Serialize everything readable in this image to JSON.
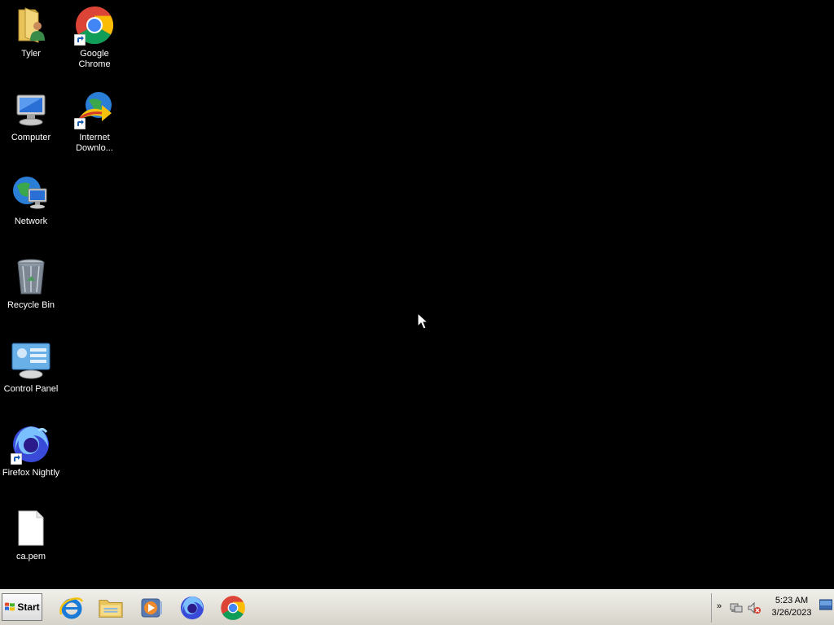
{
  "desktop": {
    "icons": [
      {
        "label": "Tyler",
        "icon": "user-folder-icon"
      },
      {
        "label": "Google Chrome",
        "icon": "chrome-icon"
      },
      {
        "label": "Computer",
        "icon": "computer-icon"
      },
      {
        "label": "Internet Downlo...",
        "label_line1": "Internet",
        "label_line2": "Downlo...",
        "icon": "internet-download-manager-icon"
      },
      {
        "label": "Network",
        "icon": "network-icon"
      },
      {
        "label": "Recycle Bin",
        "icon": "recycle-bin-icon"
      },
      {
        "label": "Control Panel",
        "icon": "control-panel-icon"
      },
      {
        "label": "Firefox Nightly",
        "icon": "firefox-nightly-icon"
      },
      {
        "label": "ca.pem",
        "icon": "file-icon"
      }
    ]
  },
  "taskbar": {
    "start_label": "Start",
    "pinned": [
      {
        "icon": "internet-explorer-icon"
      },
      {
        "icon": "file-explorer-icon"
      },
      {
        "icon": "media-player-icon"
      },
      {
        "icon": "firefox-nightly-icon"
      },
      {
        "icon": "chrome-icon"
      }
    ],
    "tray": {
      "chevron": "»",
      "time": "5:23 AM",
      "date": "3/26/2023"
    }
  },
  "colors": {
    "desktop_bg": "#000000",
    "taskbar_bg": "#e4e1d9"
  }
}
